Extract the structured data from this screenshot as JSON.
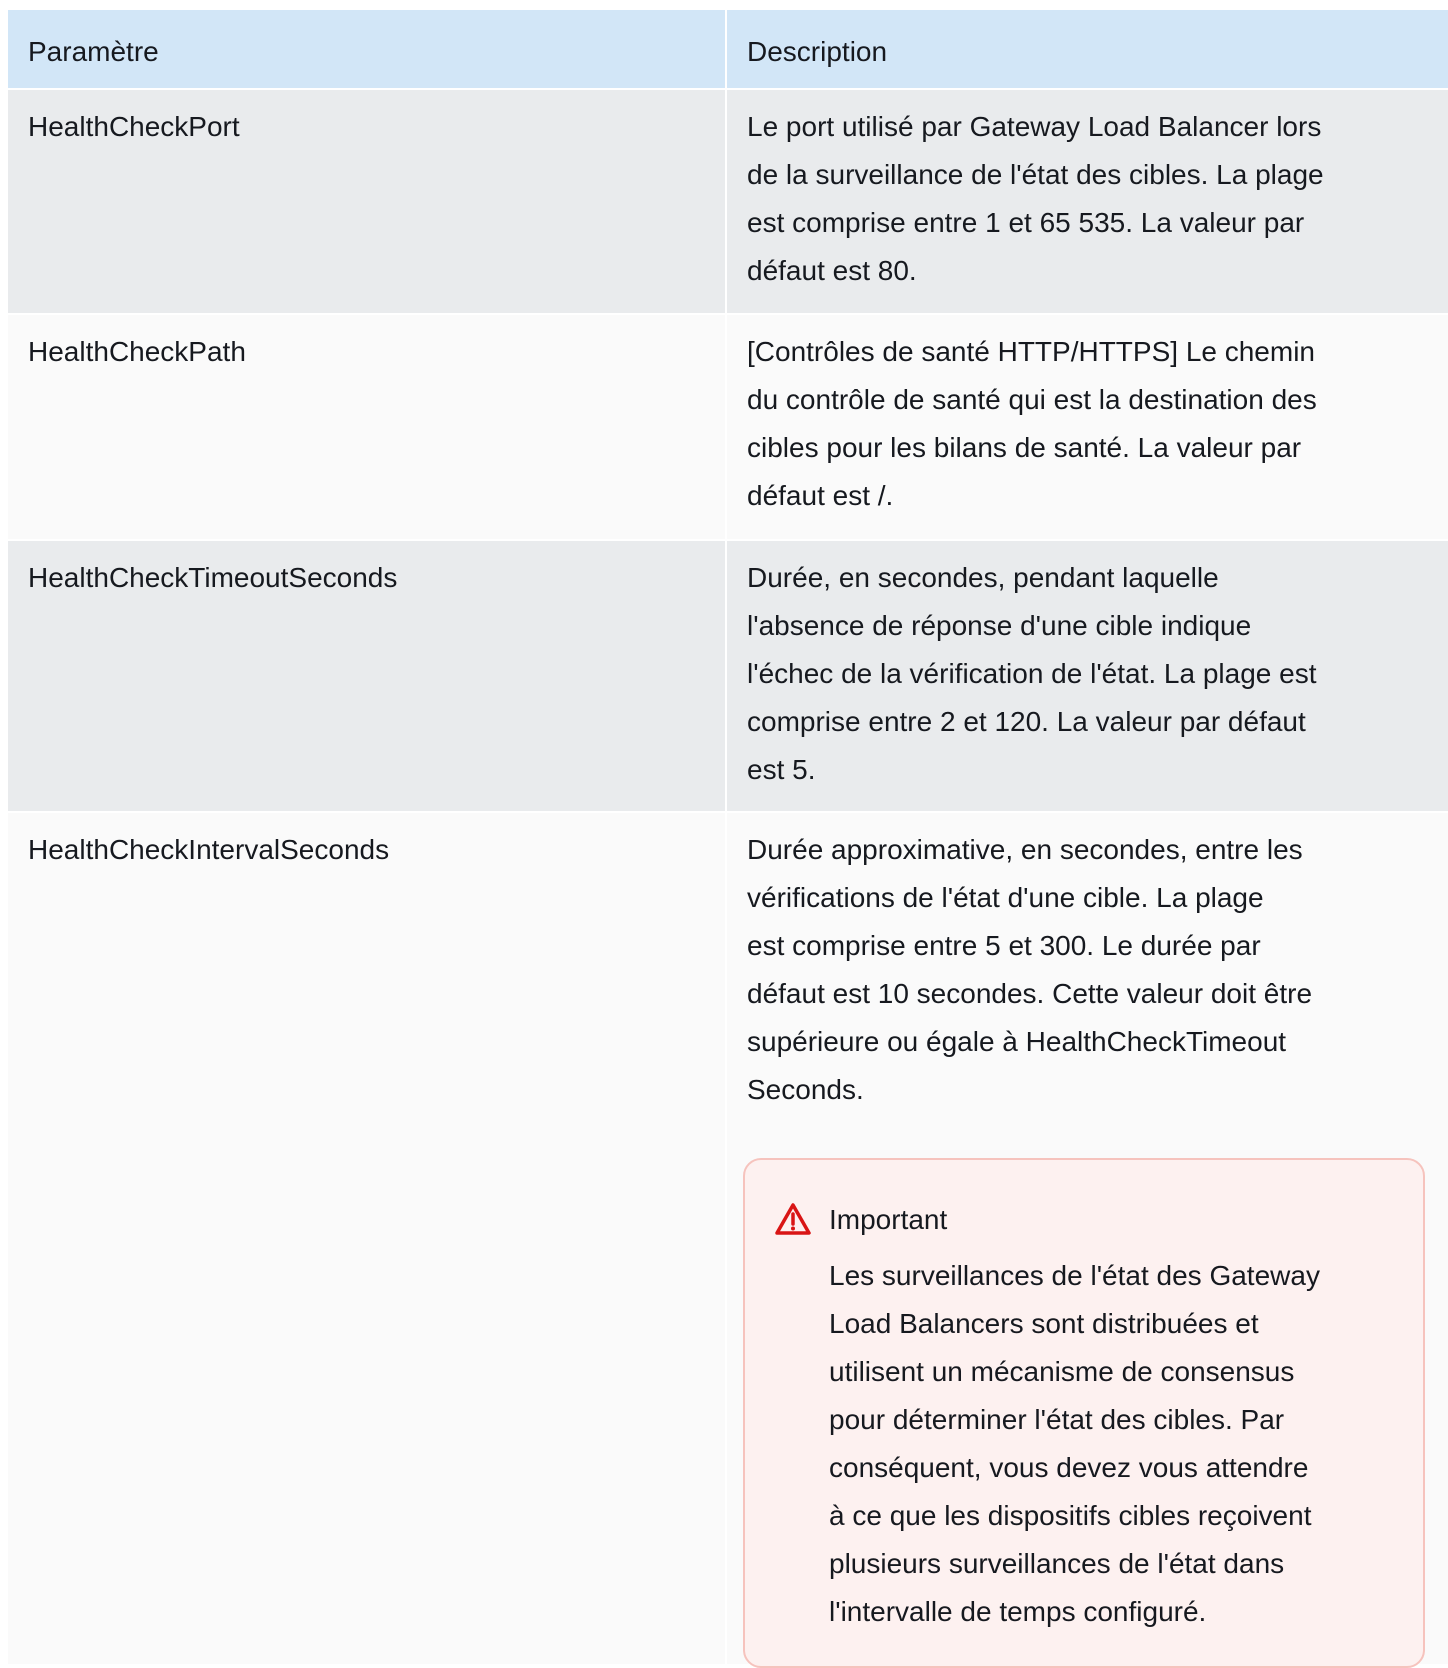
{
  "table": {
    "headers": [
      "Paramètre",
      "Description"
    ],
    "rows": [
      {
        "param": "HealthCheckPort",
        "lines": [
          "Le port utilisé par Gateway Load Balancer lors",
          "de la surveillance de l'état des cibles. La plage",
          "est comprise entre 1 et 65 535. La valeur par",
          "défaut est 80."
        ]
      },
      {
        "param": "HealthCheckPath",
        "lines": [
          "[Contrôles de santé HTTP/HTTPS] Le chemin",
          "du contrôle de santé qui est la destination des",
          "cibles pour les bilans de santé. La valeur par",
          "défaut est /."
        ]
      },
      {
        "param": "HealthCheckTimeoutSeconds",
        "lines": [
          "Durée, en secondes, pendant laquelle",
          "l'absence de réponse d'une cible indique",
          "l'échec de la vérification de l'état. La plage est",
          "comprise entre 2 et 120. La valeur par défaut",
          "est 5."
        ]
      },
      {
        "param": "HealthCheckIntervalSeconds",
        "lines": [
          "Durée approximative, en secondes, entre les",
          "vérifications de l'état d'une cible. La plage",
          "est comprise entre 5 et 300. Le durée par",
          "défaut est 10 secondes. Cette valeur doit être",
          "supérieure ou égale à HealthCheckTimeout",
          "Seconds."
        ],
        "alert": {
          "icon": "warning-icon",
          "title": "Important",
          "lines": [
            "Les surveillances de l'état des Gateway",
            "Load Balancers sont distribuées et",
            "utilisent un mécanisme de consensus",
            "pour déterminer l'état des cibles. Par",
            "conséquent, vous devez vous attendre",
            "à ce que les dispositifs cibles reçoivent",
            "plusieurs surveillances de l'état dans",
            "l'intervalle de temps configuré."
          ]
        }
      }
    ]
  },
  "colors": {
    "header_bg": "#d2e6f7",
    "row_shade": "#e9ebed",
    "row_plain": "#fafafa",
    "alert_bg": "#fdf1f0",
    "alert_border": "#f6c3bd",
    "alert_icon": "#d91515"
  }
}
